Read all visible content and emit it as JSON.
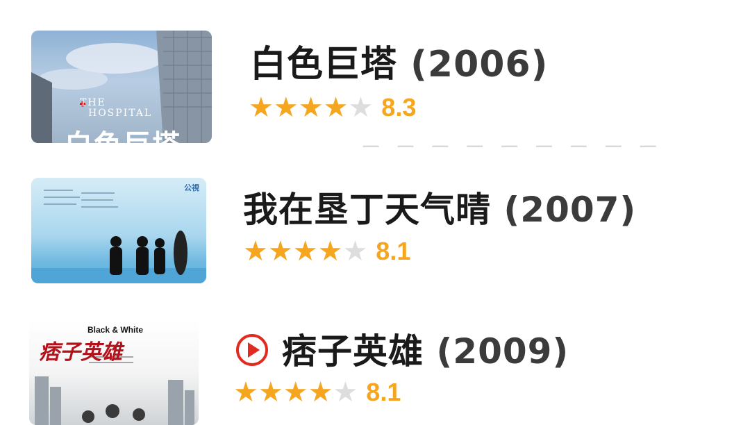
{
  "items": [
    {
      "title": "白色巨塔",
      "year": "(2006)",
      "score": "8.3",
      "rating_stars": 4,
      "poster": {
        "title_en_line1": "THE",
        "title_en_line2": "HOSPITAL",
        "title_cn": "白色巨塔"
      }
    },
    {
      "title": "我在垦丁天气晴",
      "year": "(2007)",
      "score": "8.1",
      "rating_stars": 4,
      "poster": {
        "badge": "公視"
      }
    },
    {
      "title": "痞子英雄",
      "year": "(2009)",
      "score": "8.1",
      "rating_stars": 4,
      "has_play_icon": true,
      "poster": {
        "brand": "Black & White",
        "title_cn": "痞子英雄"
      }
    }
  ],
  "colors": {
    "star": "#f6a51e",
    "star_off": "#dddddd",
    "play": "#e02b20"
  }
}
